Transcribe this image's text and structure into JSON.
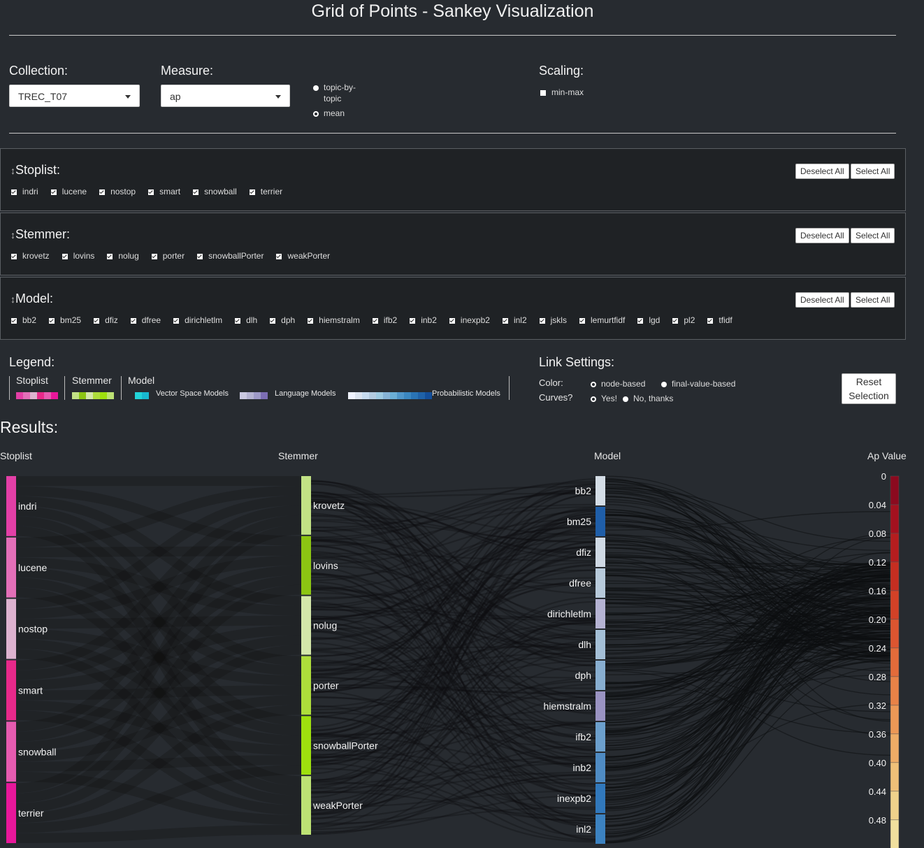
{
  "title": "Grid of Points - Sankey Visualization",
  "controls": {
    "collection_label": "Collection:",
    "collection_value": "TREC_T07",
    "measure_label": "Measure:",
    "measure_value": "ap",
    "mode_options": [
      "topic-by-topic",
      "mean"
    ],
    "mode_selected": "topic-by-topic",
    "scaling_label": "Scaling:",
    "scaling_option": "min-max"
  },
  "panels": [
    {
      "title": "Stoplist:",
      "items": [
        "indri",
        "lucene",
        "nostop",
        "smart",
        "snowball",
        "terrier"
      ]
    },
    {
      "title": "Stemmer:",
      "items": [
        "krovetz",
        "lovins",
        "nolug",
        "porter",
        "snowballPorter",
        "weakPorter"
      ]
    },
    {
      "title": "Model:",
      "items": [
        "bb2",
        "bm25",
        "dfiz",
        "dfree",
        "dirichletlm",
        "dlh",
        "dph",
        "hiemstralm",
        "ifb2",
        "inb2",
        "inexpb2",
        "inl2",
        "jskls",
        "lemurtfidf",
        "lgd",
        "pl2",
        "tfidf"
      ]
    }
  ],
  "buttons": {
    "deselect_all": "Deselect All",
    "select_all": "Select All",
    "reset_selection": "Reset Selection"
  },
  "legend": {
    "title": "Legend:",
    "stoplist": "Stoplist",
    "stemmer": "Stemmer",
    "model": "Model",
    "vsm": "Vector Space Models",
    "lm": "Language Models",
    "prob": "Probabilistic Models"
  },
  "link_settings": {
    "title": "Link Settings:",
    "color_label": "Color:",
    "color_options": [
      "node-based",
      "final-value-based"
    ],
    "color_selected": "final-value-based",
    "curves_label": "Curves?",
    "curves_options": [
      "Yes!",
      "No, thanks"
    ],
    "curves_selected": "No, thanks"
  },
  "results_title": "Results:",
  "colors": {
    "background": "#272b30",
    "stoplist": "#e7298a",
    "stemmer": "#a6d854",
    "vsm": "#22d3d8",
    "lm": "#9e9ac8",
    "prob": "#2b6fb0"
  },
  "chart_data": {
    "type": "sankey",
    "columns": [
      "Stoplist",
      "Stemmer",
      "Model",
      "Ap Value"
    ],
    "stoplist_nodes": [
      {
        "name": "indri",
        "color": "#e33fa6"
      },
      {
        "name": "lucene",
        "color": "#e36fb8"
      },
      {
        "name": "nostop",
        "color": "#ddb2cf"
      },
      {
        "name": "smart",
        "color": "#e7298a"
      },
      {
        "name": "snowball",
        "color": "#e55bb0"
      },
      {
        "name": "terrier",
        "color": "#e8179a"
      }
    ],
    "stemmer_nodes": [
      {
        "name": "krovetz",
        "color": "#c2e285"
      },
      {
        "name": "lovins",
        "color": "#8cc513"
      },
      {
        "name": "nolug",
        "color": "#d4e7aa"
      },
      {
        "name": "porter",
        "color": "#aedd3b"
      },
      {
        "name": "snowballPorter",
        "color": "#9ee00e"
      },
      {
        "name": "weakPorter",
        "color": "#bde274"
      }
    ],
    "model_nodes": [
      {
        "name": "bb2",
        "color": "#d4dde6"
      },
      {
        "name": "bm25",
        "color": "#1f5ea8"
      },
      {
        "name": "dfiz",
        "color": "#cfd9e4"
      },
      {
        "name": "dfree",
        "color": "#b8cadb"
      },
      {
        "name": "dirichletlm",
        "color": "#b5b3d3"
      },
      {
        "name": "dlh",
        "color": "#a4bfd6"
      },
      {
        "name": "dph",
        "color": "#88aed0"
      },
      {
        "name": "hiemstralm",
        "color": "#9a93c2"
      },
      {
        "name": "ifb2",
        "color": "#6c9fcc"
      },
      {
        "name": "inb2",
        "color": "#4f8bc3"
      },
      {
        "name": "inexpb2",
        "color": "#3178bb"
      },
      {
        "name": "inl2",
        "color": "#3c82c0"
      }
    ],
    "ap_ticks": [
      "0",
      "0.04",
      "0.08",
      "0.12",
      "0.16",
      "0.20",
      "0.24",
      "0.28",
      "0.32",
      "0.36",
      "0.40",
      "0.44",
      "0.48"
    ],
    "ap_colors": [
      "#8b0a1f",
      "#a3111f",
      "#b51d1f",
      "#c52e21",
      "#d24127",
      "#dc5530",
      "#e36b3a",
      "#e88247",
      "#ec9856",
      "#eeac66",
      "#efc078",
      "#efd18b",
      "#f0df9e"
    ]
  }
}
